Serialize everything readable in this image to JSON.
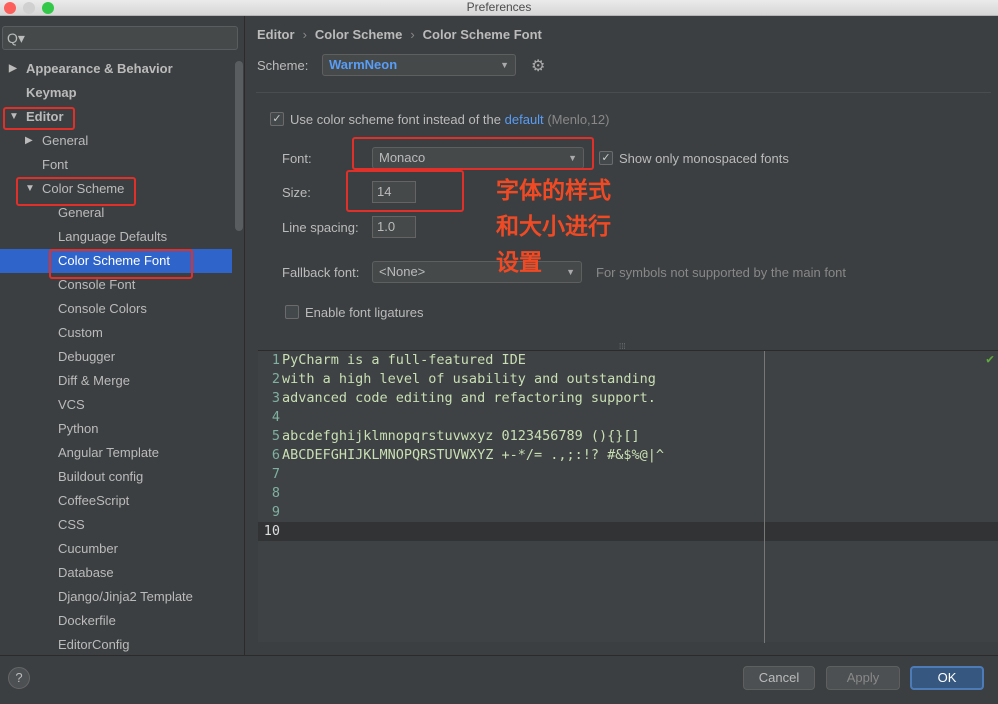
{
  "window": {
    "title": "Preferences"
  },
  "sidebar": {
    "search_placeholder": "Q▾",
    "items": [
      {
        "label": "Appearance & Behavior",
        "level": 0,
        "arrow": "▶",
        "bold": true
      },
      {
        "label": "Keymap",
        "level": 0,
        "bold": true
      },
      {
        "label": "Editor",
        "level": 0,
        "arrow": "▼",
        "bold": true
      },
      {
        "label": "General",
        "level": 1,
        "arrow": "▶"
      },
      {
        "label": "Font",
        "level": 1
      },
      {
        "label": "Color Scheme",
        "level": 1,
        "arrow": "▼"
      },
      {
        "label": "General",
        "level": 2
      },
      {
        "label": "Language Defaults",
        "level": 2
      },
      {
        "label": "Color Scheme Font",
        "level": 2,
        "selected": true
      },
      {
        "label": "Console Font",
        "level": 2
      },
      {
        "label": "Console Colors",
        "level": 2
      },
      {
        "label": "Custom",
        "level": 2
      },
      {
        "label": "Debugger",
        "level": 2
      },
      {
        "label": "Diff & Merge",
        "level": 2
      },
      {
        "label": "VCS",
        "level": 2
      },
      {
        "label": "Python",
        "level": 2
      },
      {
        "label": "Angular Template",
        "level": 2
      },
      {
        "label": "Buildout config",
        "level": 2
      },
      {
        "label": "CoffeeScript",
        "level": 2
      },
      {
        "label": "CSS",
        "level": 2
      },
      {
        "label": "Cucumber",
        "level": 2
      },
      {
        "label": "Database",
        "level": 2
      },
      {
        "label": "Django/Jinja2 Template",
        "level": 2
      },
      {
        "label": "Dockerfile",
        "level": 2
      },
      {
        "label": "EditorConfig",
        "level": 2
      }
    ]
  },
  "breadcrumb": [
    "Editor",
    "Color Scheme",
    "Color Scheme Font"
  ],
  "scheme": {
    "label": "Scheme:",
    "value": "WarmNeon"
  },
  "use_scheme_font": {
    "checked": true,
    "text": "Use color scheme font instead of the",
    "link": "default",
    "suffix": "(Menlo,12)"
  },
  "font": {
    "label": "Font:",
    "value": "Monaco"
  },
  "mono_only": {
    "checked": true,
    "label": "Show only monospaced fonts"
  },
  "size": {
    "label": "Size:",
    "value": "14"
  },
  "line_spacing": {
    "label": "Line spacing:",
    "value": "1.0"
  },
  "fallback": {
    "label": "Fallback font:",
    "value": "<None>",
    "hint": "For symbols not supported by the main font"
  },
  "ligatures": {
    "checked": false,
    "label": "Enable font ligatures"
  },
  "annotation": [
    "字体的样式",
    "和大小进行",
    "设置"
  ],
  "preview_lines": [
    "PyCharm is a full-featured IDE",
    "with a high level of usability and outstanding",
    "advanced code editing and refactoring support.",
    "",
    "abcdefghijklmnopqrstuvwxyz 0123456789 (){}[]",
    "ABCDEFGHIJKLMNOPQRSTUVWXYZ +-*/= .,;:!? #&$%@|^",
    "",
    "",
    "",
    ""
  ],
  "buttons": {
    "help": "?",
    "cancel": "Cancel",
    "apply": "Apply",
    "ok": "OK"
  },
  "colors": {
    "selection": "#2f65ca",
    "annotation": "#e0302a",
    "accent": "#589df6"
  }
}
